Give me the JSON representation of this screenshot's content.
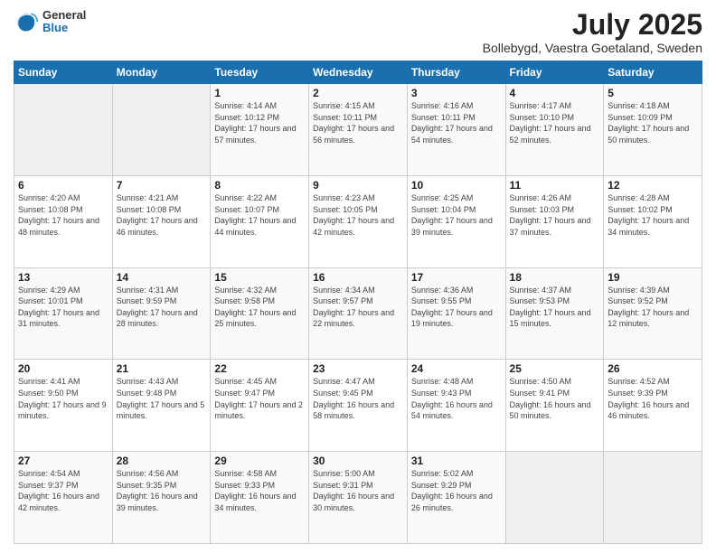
{
  "header": {
    "logo_general": "General",
    "logo_blue": "Blue",
    "title": "July 2025",
    "subtitle": "Bollebygd, Vaestra Goetaland, Sweden"
  },
  "columns": [
    "Sunday",
    "Monday",
    "Tuesday",
    "Wednesday",
    "Thursday",
    "Friday",
    "Saturday"
  ],
  "weeks": [
    [
      {
        "day": "",
        "info": ""
      },
      {
        "day": "",
        "info": ""
      },
      {
        "day": "1",
        "info": "Sunrise: 4:14 AM\nSunset: 10:12 PM\nDaylight: 17 hours and 57 minutes."
      },
      {
        "day": "2",
        "info": "Sunrise: 4:15 AM\nSunset: 10:11 PM\nDaylight: 17 hours and 56 minutes."
      },
      {
        "day": "3",
        "info": "Sunrise: 4:16 AM\nSunset: 10:11 PM\nDaylight: 17 hours and 54 minutes."
      },
      {
        "day": "4",
        "info": "Sunrise: 4:17 AM\nSunset: 10:10 PM\nDaylight: 17 hours and 52 minutes."
      },
      {
        "day": "5",
        "info": "Sunrise: 4:18 AM\nSunset: 10:09 PM\nDaylight: 17 hours and 50 minutes."
      }
    ],
    [
      {
        "day": "6",
        "info": "Sunrise: 4:20 AM\nSunset: 10:08 PM\nDaylight: 17 hours and 48 minutes."
      },
      {
        "day": "7",
        "info": "Sunrise: 4:21 AM\nSunset: 10:08 PM\nDaylight: 17 hours and 46 minutes."
      },
      {
        "day": "8",
        "info": "Sunrise: 4:22 AM\nSunset: 10:07 PM\nDaylight: 17 hours and 44 minutes."
      },
      {
        "day": "9",
        "info": "Sunrise: 4:23 AM\nSunset: 10:05 PM\nDaylight: 17 hours and 42 minutes."
      },
      {
        "day": "10",
        "info": "Sunrise: 4:25 AM\nSunset: 10:04 PM\nDaylight: 17 hours and 39 minutes."
      },
      {
        "day": "11",
        "info": "Sunrise: 4:26 AM\nSunset: 10:03 PM\nDaylight: 17 hours and 37 minutes."
      },
      {
        "day": "12",
        "info": "Sunrise: 4:28 AM\nSunset: 10:02 PM\nDaylight: 17 hours and 34 minutes."
      }
    ],
    [
      {
        "day": "13",
        "info": "Sunrise: 4:29 AM\nSunset: 10:01 PM\nDaylight: 17 hours and 31 minutes."
      },
      {
        "day": "14",
        "info": "Sunrise: 4:31 AM\nSunset: 9:59 PM\nDaylight: 17 hours and 28 minutes."
      },
      {
        "day": "15",
        "info": "Sunrise: 4:32 AM\nSunset: 9:58 PM\nDaylight: 17 hours and 25 minutes."
      },
      {
        "day": "16",
        "info": "Sunrise: 4:34 AM\nSunset: 9:57 PM\nDaylight: 17 hours and 22 minutes."
      },
      {
        "day": "17",
        "info": "Sunrise: 4:36 AM\nSunset: 9:55 PM\nDaylight: 17 hours and 19 minutes."
      },
      {
        "day": "18",
        "info": "Sunrise: 4:37 AM\nSunset: 9:53 PM\nDaylight: 17 hours and 15 minutes."
      },
      {
        "day": "19",
        "info": "Sunrise: 4:39 AM\nSunset: 9:52 PM\nDaylight: 17 hours and 12 minutes."
      }
    ],
    [
      {
        "day": "20",
        "info": "Sunrise: 4:41 AM\nSunset: 9:50 PM\nDaylight: 17 hours and 9 minutes."
      },
      {
        "day": "21",
        "info": "Sunrise: 4:43 AM\nSunset: 9:48 PM\nDaylight: 17 hours and 5 minutes."
      },
      {
        "day": "22",
        "info": "Sunrise: 4:45 AM\nSunset: 9:47 PM\nDaylight: 17 hours and 2 minutes."
      },
      {
        "day": "23",
        "info": "Sunrise: 4:47 AM\nSunset: 9:45 PM\nDaylight: 16 hours and 58 minutes."
      },
      {
        "day": "24",
        "info": "Sunrise: 4:48 AM\nSunset: 9:43 PM\nDaylight: 16 hours and 54 minutes."
      },
      {
        "day": "25",
        "info": "Sunrise: 4:50 AM\nSunset: 9:41 PM\nDaylight: 16 hours and 50 minutes."
      },
      {
        "day": "26",
        "info": "Sunrise: 4:52 AM\nSunset: 9:39 PM\nDaylight: 16 hours and 46 minutes."
      }
    ],
    [
      {
        "day": "27",
        "info": "Sunrise: 4:54 AM\nSunset: 9:37 PM\nDaylight: 16 hours and 42 minutes."
      },
      {
        "day": "28",
        "info": "Sunrise: 4:56 AM\nSunset: 9:35 PM\nDaylight: 16 hours and 39 minutes."
      },
      {
        "day": "29",
        "info": "Sunrise: 4:58 AM\nSunset: 9:33 PM\nDaylight: 16 hours and 34 minutes."
      },
      {
        "day": "30",
        "info": "Sunrise: 5:00 AM\nSunset: 9:31 PM\nDaylight: 16 hours and 30 minutes."
      },
      {
        "day": "31",
        "info": "Sunrise: 5:02 AM\nSunset: 9:29 PM\nDaylight: 16 hours and 26 minutes."
      },
      {
        "day": "",
        "info": ""
      },
      {
        "day": "",
        "info": ""
      }
    ]
  ]
}
